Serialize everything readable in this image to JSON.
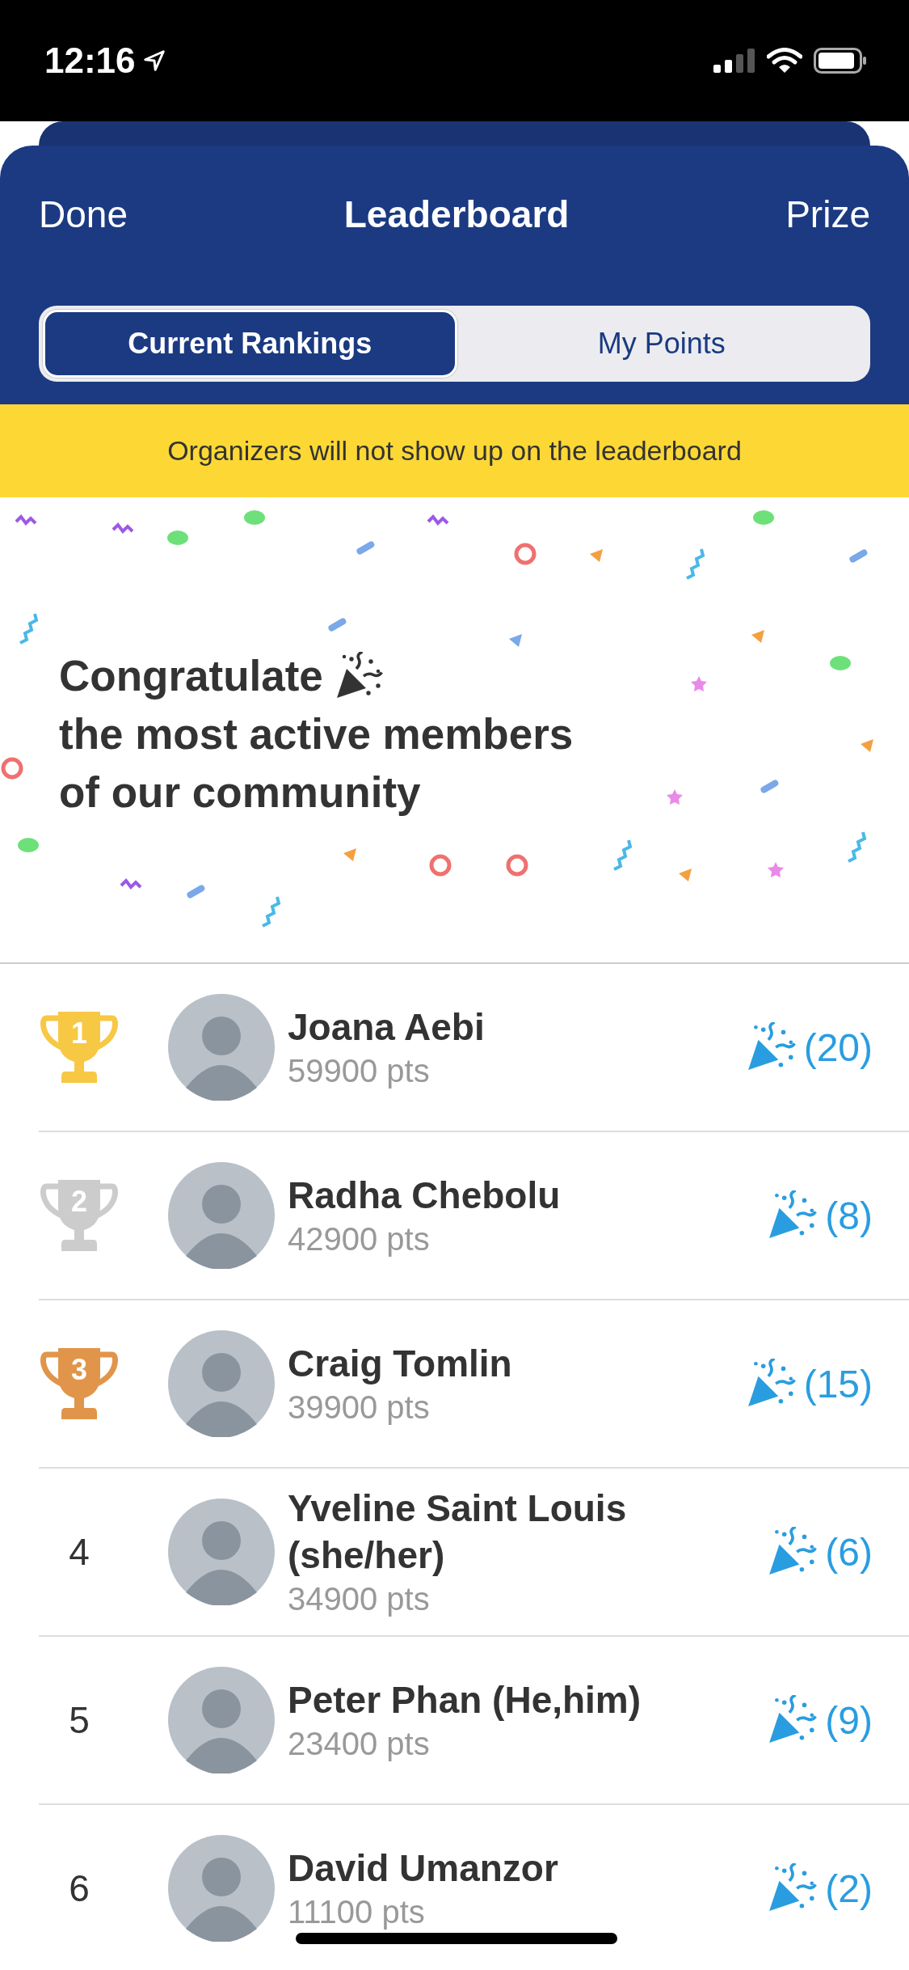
{
  "status_bar": {
    "time": "12:16"
  },
  "nav": {
    "left": "Done",
    "title": "Leaderboard",
    "right": "Prize"
  },
  "tabs": [
    {
      "label": "Current Rankings",
      "selected": true
    },
    {
      "label": "My Points",
      "selected": false
    }
  ],
  "notice": "Organizers will not show up on the leaderboard",
  "congrats": {
    "lines": [
      "Congratulate",
      "the most active members",
      "of our community"
    ]
  },
  "rows": [
    {
      "kind": "trophy",
      "color": "#f7c843",
      "rank": "1",
      "name": "Joana Aebi",
      "points": "59900 pts",
      "cheers": "(20)"
    },
    {
      "kind": "trophy",
      "color": "#cccccc",
      "rank": "2",
      "name": "Radha Chebolu",
      "points": "42900 pts",
      "cheers": "(8)"
    },
    {
      "kind": "trophy",
      "color": "#e0954a",
      "rank": "3",
      "name": "Craig Tomlin",
      "points": "39900 pts",
      "cheers": "(15)"
    },
    {
      "kind": "plain",
      "rank": "4",
      "name": "Yveline Saint Louis (she/her)",
      "points": "34900 pts",
      "cheers": "(6)"
    },
    {
      "kind": "plain",
      "rank": "5",
      "name": "Peter Phan (He,him)",
      "points": "23400 pts",
      "cheers": "(9)"
    },
    {
      "kind": "plain",
      "rank": "6",
      "name": "David Umanzor",
      "points": "11100 pts",
      "cheers": "(2)"
    }
  ]
}
